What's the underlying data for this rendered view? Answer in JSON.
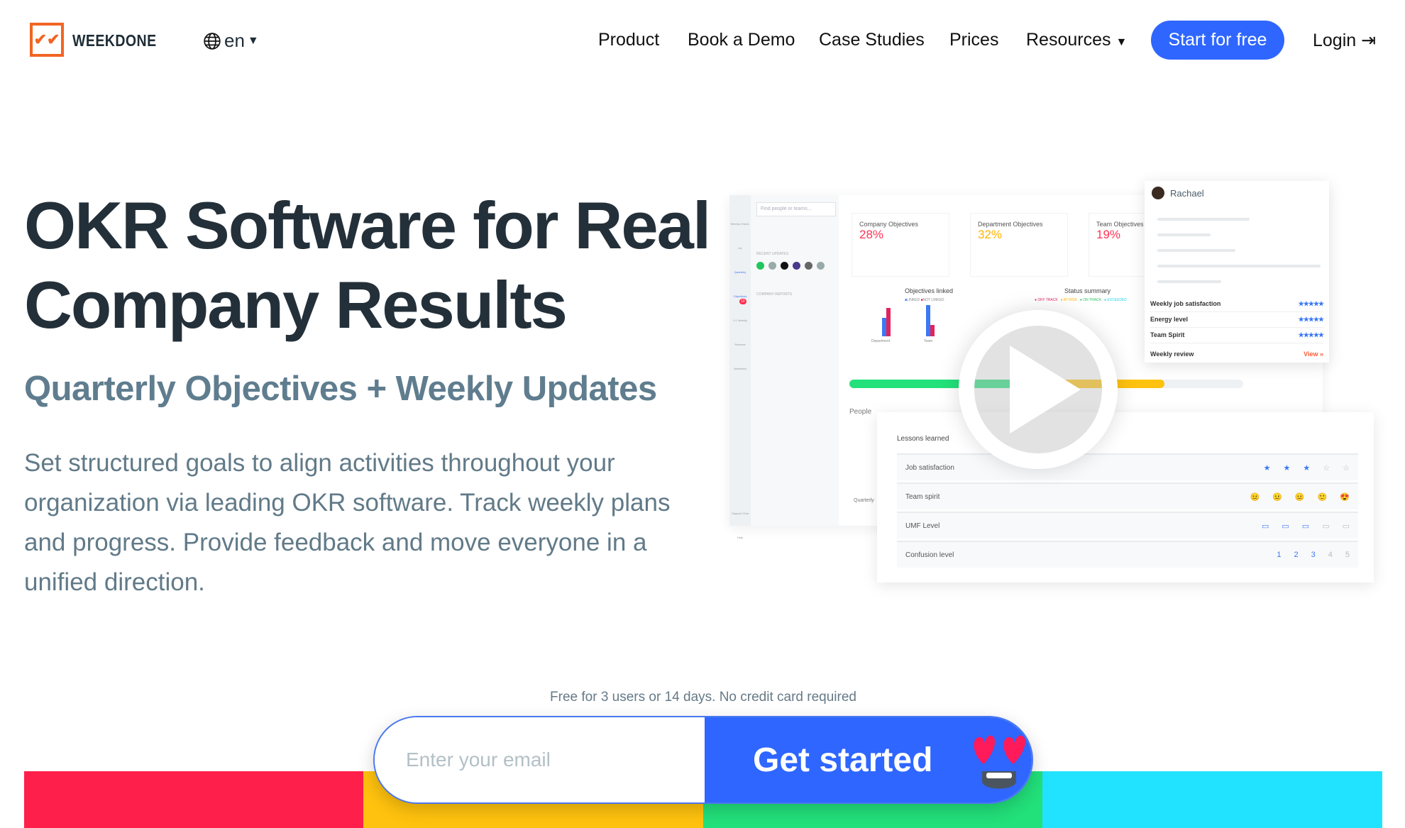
{
  "header": {
    "brand": "WEEKDONE",
    "language": "en",
    "nav": [
      "Product",
      "Book a Demo",
      "Case Studies",
      "Prices",
      "Resources"
    ],
    "start_label": "Start for free",
    "login_label": "Login",
    "accent": "#2e66ff",
    "logo_color": "#f26522"
  },
  "hero": {
    "title_line1": "OKR Software for Real",
    "title_line2": "Company Results",
    "subtitle": "Quarterly Objectives + Weekly Updates",
    "description": "Set structured goals to align activities throughout your organization via leading OKR software. Track weekly plans and progress. Provide feedback and move everyone in a unified direction."
  },
  "signup": {
    "note": "Free for 3 users or 14 days. No credit card required",
    "email_placeholder": "Enter your email",
    "button_label": "Get started"
  },
  "color_bars": [
    "#ff1f4b",
    "#ffc20e",
    "#22e07a",
    "#22e3ff"
  ],
  "mockup": {
    "search_placeholder": "Find people or teams...",
    "sidebar": [
      "Weekly Check-ins",
      "Quarterly Objectives",
      "1:1 Weekly Reviews",
      "Newsfeed",
      "Support Chat",
      "Help"
    ],
    "newsfeed_badge": "10",
    "recent_updates": "RECENT UPDATES",
    "company_reports": "COMPANY REPORTS",
    "objectives": [
      {
        "label": "Company Objectives",
        "value": "28%",
        "color": "#ff3355"
      },
      {
        "label": "Department Objectives",
        "value": "32%",
        "color": "#ffb400"
      },
      {
        "label": "Team Objectives",
        "value": "19%",
        "color": "#ff3355"
      }
    ],
    "objectives_linked": "Objectives linked",
    "linked_legend": [
      "LINKED",
      "NOT LINKED"
    ],
    "bar_labels": [
      "Department",
      "Team"
    ],
    "status_summary": "Status summary",
    "status_legend": [
      "OFF TRACK",
      "AT RISK",
      "ON TRACK",
      "EXCEEDED"
    ],
    "progress": {
      "green": 0.45,
      "yellow": 0.8
    },
    "people": "People",
    "quarterly": "Quarterly",
    "rachael": {
      "name": "Rachael",
      "rows": [
        {
          "label": "Weekly job satisfaction",
          "stars": "★★★★★"
        },
        {
          "label": "Energy level",
          "stars": "★★★★★"
        },
        {
          "label": "Team Spirit",
          "stars": "★★★★★"
        }
      ],
      "review_label": "Weekly review",
      "view_label": "View »"
    },
    "lessons": {
      "title": "Lessons learned",
      "rows": [
        {
          "label": "Job satisfaction",
          "values": [
            "★",
            "★",
            "★",
            "☆",
            "☆"
          ]
        },
        {
          "label": "Team spirit",
          "values": [
            "😐",
            "😐",
            "😐",
            "🙂",
            "😍"
          ]
        },
        {
          "label": "UMF Level",
          "values": [
            "▭",
            "▭",
            "▭",
            "▭",
            "▭"
          ]
        },
        {
          "label": "Confusion level",
          "values": [
            "1",
            "2",
            "3",
            "4",
            "5"
          ]
        }
      ]
    }
  }
}
